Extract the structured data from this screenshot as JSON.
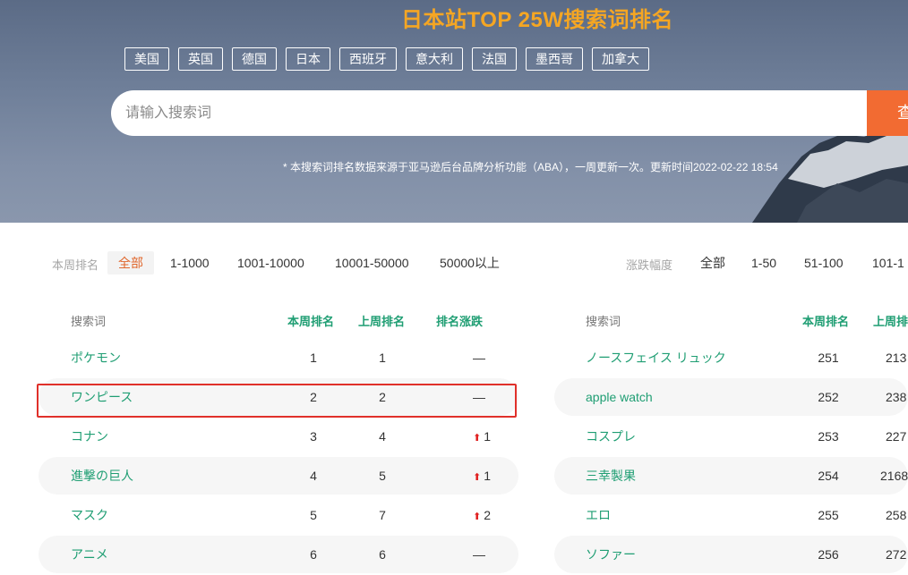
{
  "hero": {
    "title": "日本站TOP 25W搜索词排名",
    "countries": [
      "美国",
      "英国",
      "德国",
      "日本",
      "西班牙",
      "意大利",
      "法国",
      "墨西哥",
      "加拿大"
    ],
    "search": {
      "placeholder": "请输入搜索词",
      "button_label": "查"
    },
    "note": "* 本搜索词排名数据来源于亚马逊后台品牌分析功能（ABA），一周更新一次。更新时间2022-02-22 18:54"
  },
  "filters": {
    "rank_label": "本周排名",
    "rank_options": [
      "全部",
      "1-1000",
      "1001-10000",
      "10001-50000",
      "50000以上"
    ],
    "change_label": "涨跌幅度",
    "change_options": [
      "全部",
      "1-50",
      "51-100",
      "101-1"
    ]
  },
  "left_table": {
    "headers": {
      "term": "搜索词",
      "this_week": "本周排名",
      "last_week": "上周排名",
      "change": "排名涨跌"
    },
    "rows": [
      {
        "term": "ポケモン",
        "this_week": "1",
        "last_week": "1",
        "change": "—",
        "up": false
      },
      {
        "term": "ワンピース",
        "this_week": "2",
        "last_week": "2",
        "change": "—",
        "up": false
      },
      {
        "term": "コナン",
        "this_week": "3",
        "last_week": "4",
        "change": "1",
        "up": true
      },
      {
        "term": "進撃の巨人",
        "this_week": "4",
        "last_week": "5",
        "change": "1",
        "up": true
      },
      {
        "term": "マスク",
        "this_week": "5",
        "last_week": "7",
        "change": "2",
        "up": true
      },
      {
        "term": "アニメ",
        "this_week": "6",
        "last_week": "6",
        "change": "—",
        "up": false
      }
    ]
  },
  "right_table": {
    "headers": {
      "term": "搜索词",
      "this_week": "本周排名",
      "last_week": "上周排"
    },
    "rows": [
      {
        "term": "ノースフェイス リュック",
        "this_week": "251",
        "last_week": "213"
      },
      {
        "term": "apple watch",
        "this_week": "252",
        "last_week": "238"
      },
      {
        "term": "コスプレ",
        "this_week": "253",
        "last_week": "227"
      },
      {
        "term": "三幸製果",
        "this_week": "254",
        "last_week": "2168"
      },
      {
        "term": "エロ",
        "this_week": "255",
        "last_week": "258"
      },
      {
        "term": "ソファー",
        "this_week": "256",
        "last_week": "272"
      }
    ]
  },
  "colors": {
    "accent_orange": "#f26b32",
    "title_orange": "#f5a623",
    "term_green": "#1f9e73",
    "up_red": "#e02020",
    "highlight_red": "#e0302a"
  },
  "icons": {
    "up": "up-arrow-icon"
  }
}
